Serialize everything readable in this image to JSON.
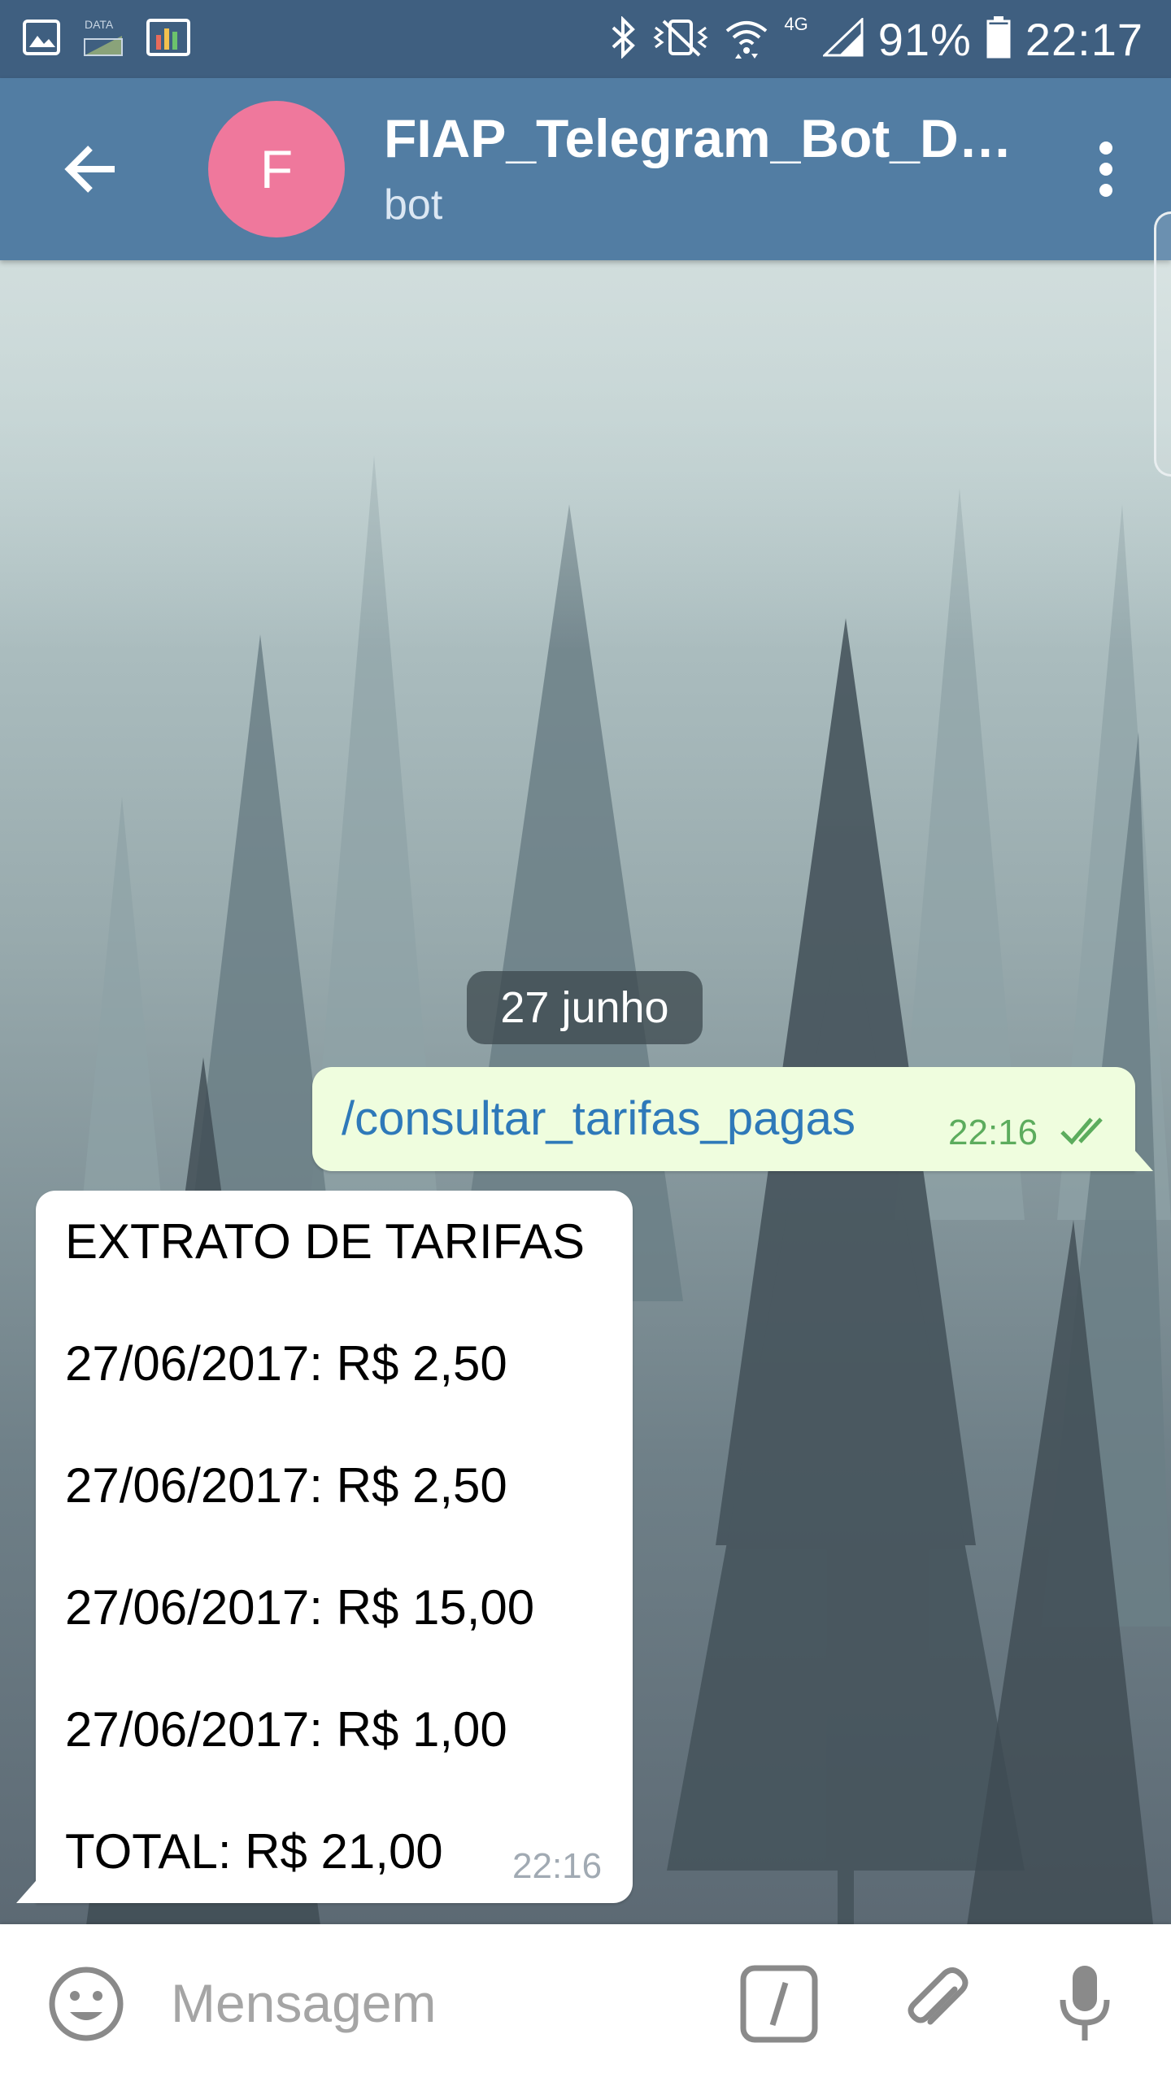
{
  "status_bar": {
    "data_label": "DATA",
    "network_label": "4G",
    "battery_percent": "91%",
    "time": "22:17"
  },
  "header": {
    "avatar_letter": "F",
    "title": "FIAP_Telegram_Bot_D…",
    "subtitle": "bot"
  },
  "chat": {
    "date_label": "27 junho",
    "outgoing": {
      "text": "/consultar_tarifas_pagas",
      "time": "22:16"
    },
    "incoming": {
      "lines": [
        "EXTRATO DE TARIFAS",
        "27/06/2017: R$ 2,50",
        "27/06/2017: R$ 2,50",
        "27/06/2017: R$ 15,00",
        "27/06/2017: R$ 1,00",
        "TOTAL: R$ 21,00"
      ],
      "time": "22:16"
    }
  },
  "composer": {
    "placeholder": "Mensagem"
  },
  "colors": {
    "status_bar": "#3f5f80",
    "app_bar": "#527da3",
    "avatar": "#ef789c",
    "outgoing_bubble": "#effdde",
    "link": "#2e79b9",
    "read_ticks": "#5cac5d"
  }
}
